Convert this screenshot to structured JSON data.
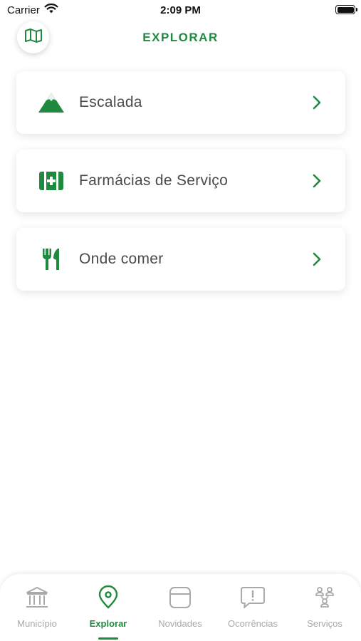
{
  "status_bar": {
    "carrier": "Carrier",
    "time": "2:09 PM"
  },
  "header": {
    "title": "EXPLORAR",
    "map_icon": "map-icon"
  },
  "colors": {
    "accent": "#1f8a3f",
    "inactive": "#a9a9a9",
    "text": "#4a4a4a"
  },
  "menu": [
    {
      "label": "Escalada",
      "icon": "mountain-icon"
    },
    {
      "label": "Farmácias de Serviço",
      "icon": "first-aid-kit-icon"
    },
    {
      "label": "Onde comer",
      "icon": "fork-knife-icon"
    }
  ],
  "tabs": [
    {
      "label": "Município",
      "icon": "town-hall-icon",
      "active": false
    },
    {
      "label": "Explorar",
      "icon": "location-pin-icon",
      "active": true
    },
    {
      "label": "Novidades",
      "icon": "news-card-icon",
      "active": false
    },
    {
      "label": "Ocorrências",
      "icon": "alert-bubble-icon",
      "active": false
    },
    {
      "label": "Serviços",
      "icon": "people-network-icon",
      "active": false
    }
  ]
}
